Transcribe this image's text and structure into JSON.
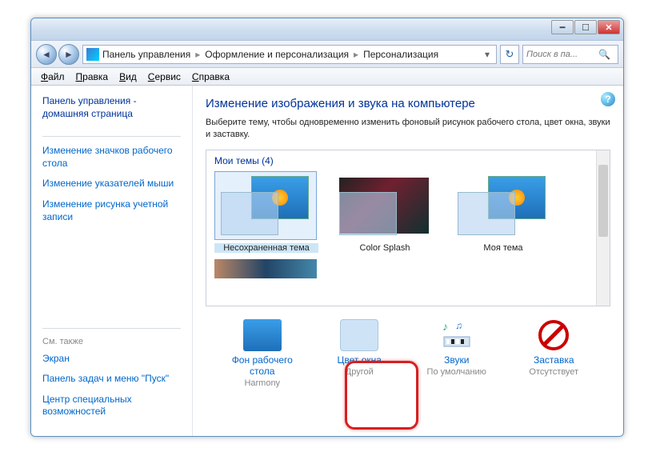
{
  "breadcrumb": {
    "root": "Панель управления",
    "mid": "Оформление и персонализация",
    "leaf": "Персонализация"
  },
  "search": {
    "placeholder": "Поиск в па..."
  },
  "menu": {
    "file": "Файл",
    "edit": "Правка",
    "view": "Вид",
    "tools": "Сервис",
    "help": "Справка"
  },
  "sidebar": {
    "home": "Панель управления - домашняя страница",
    "links": [
      "Изменение значков рабочего стола",
      "Изменение указателей мыши",
      "Изменение рисунка учетной записи"
    ],
    "seealso_label": "См. также",
    "seealso": [
      "Экран",
      "Панель задач и меню \"Пуск\"",
      "Центр специальных возможностей"
    ]
  },
  "main": {
    "heading": "Изменение изображения и звука на компьютере",
    "desc": "Выберите тему, чтобы одновременно изменить фоновый рисунок рабочего стола, цвет окна, звуки и заставку.",
    "themes_label": "Мои темы (4)",
    "themes": [
      {
        "name": "Несохраненная тема",
        "selected": true,
        "style": "aero"
      },
      {
        "name": "Color Splash",
        "selected": false,
        "style": "splash"
      },
      {
        "name": "Моя тема",
        "selected": false,
        "style": "aero"
      }
    ]
  },
  "bottom": {
    "items": [
      {
        "label": "Фон рабочего стола",
        "sub": "Harmony",
        "icon": "desktop"
      },
      {
        "label": "Цвет окна",
        "sub": "Другой",
        "icon": "color"
      },
      {
        "label": "Звуки",
        "sub": "По умолчанию",
        "icon": "sound"
      },
      {
        "label": "Заставка",
        "sub": "Отсутствует",
        "icon": "saver"
      }
    ]
  }
}
